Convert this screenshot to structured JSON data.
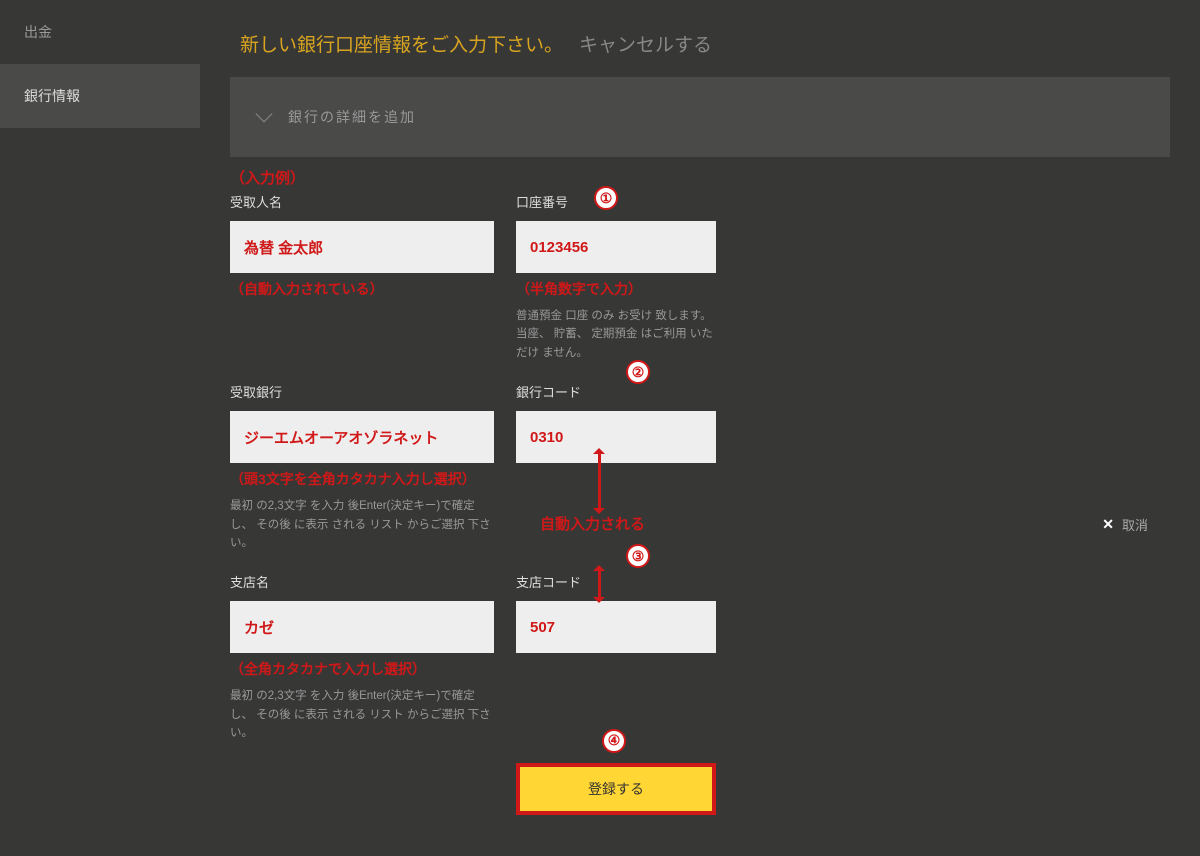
{
  "sidebar": {
    "items": [
      {
        "label": "出金",
        "active": false
      },
      {
        "label": "銀行情報",
        "active": true
      }
    ]
  },
  "header": {
    "title": "新しい銀行口座情報をご入力下さい。",
    "cancel": "キャンセルする"
  },
  "accordion": {
    "label": "銀行の詳細を追加"
  },
  "form": {
    "example_label": "（入力例）",
    "recipient_name": {
      "label": "受取人名",
      "value": "為替 金太郎",
      "note": "（自動入力されている）"
    },
    "account_number": {
      "label": "口座番号",
      "value": "0123456",
      "note": "（半角数字で入力）",
      "help": "普通預金 口座 のみ お受け 致します。 当座、 貯蓄、 定期預金 はご利用 いただけ ません。",
      "step": "①"
    },
    "recipient_bank": {
      "label": "受取銀行",
      "value": "ジーエムオーアオゾラネット",
      "note": "（頭3文字を全角カタカナ入力し選択）",
      "help": "最初 の2,3文字 を入力 後Enter(決定キー)で確定し、 その後 に表示 される リスト からご選択 下さい。",
      "step": "②"
    },
    "bank_code": {
      "label": "銀行コード",
      "value": "0310"
    },
    "branch_name": {
      "label": "支店名",
      "value": "カゼ",
      "note": "（全角カタカナで入力し選択）",
      "help": "最初 の2,3文字 を入力 後Enter(決定キー)で確定し、 その後 に表示 される リスト からご選択 下さい。",
      "step": "③"
    },
    "branch_code": {
      "label": "支店コード",
      "value": "507"
    },
    "auto_filled": "自動入力される",
    "submit": {
      "label": "登録する",
      "step": "④"
    }
  },
  "right_panel": {
    "cancel": "取消",
    "x": "✕"
  }
}
